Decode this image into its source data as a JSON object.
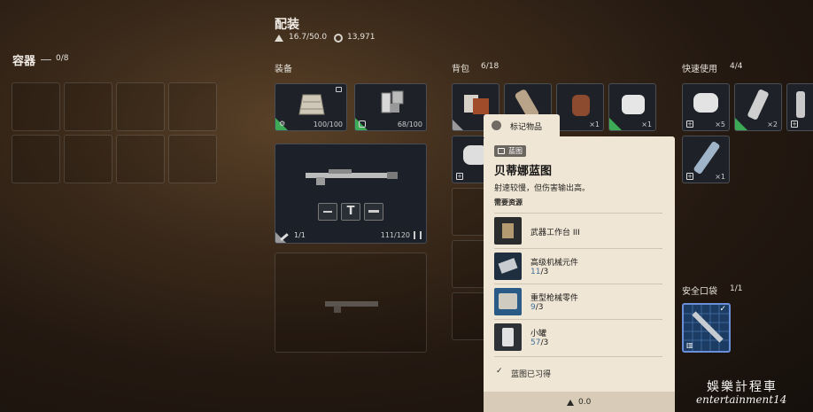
{
  "header": {
    "title": "配装",
    "weight": "16.7/50.0",
    "credits": "13,971"
  },
  "container": {
    "title": "容器",
    "count": "0/8"
  },
  "equipment": {
    "title": "装备",
    "shield": {
      "durability": "100/100",
      "icon": "shield-icon"
    },
    "augment": {
      "durability": "68/100",
      "icon": "augment-icon"
    },
    "weapon": {
      "count": "1/1",
      "ammo": "111/120",
      "attachments": [
        "barrel-icon",
        "tech-icon",
        "stock-icon"
      ]
    }
  },
  "backpack": {
    "title": "背包",
    "count": "6/18",
    "items": [
      {
        "qty": ""
      },
      {
        "qty": ""
      },
      {
        "qty": "×1"
      },
      {
        "qty": "×1"
      },
      {
        "qty": ""
      }
    ]
  },
  "quick_use": {
    "title": "快速使用",
    "count": "4/4",
    "items": [
      {
        "qty": "×5"
      },
      {
        "qty": "×2"
      },
      {
        "qty": ""
      },
      {
        "qty": "×1"
      }
    ]
  },
  "safe_pocket": {
    "title": "安全口袋",
    "count": "1/1"
  },
  "tooltip": {
    "mark_label": "标记物品",
    "tag": "蓝图",
    "name": "贝蒂娜蓝图",
    "desc": "射速较慢，但伤害输出高。",
    "resources_title": "需要资源",
    "resources": [
      {
        "name": "武器工作台 III",
        "have": "",
        "need": ""
      },
      {
        "name": "高级机械元件",
        "have": "11",
        "need": "/3"
      },
      {
        "name": "重型枪械零件",
        "have": "9",
        "need": "/3"
      },
      {
        "name": "小罐",
        "have": "57",
        "need": "/3"
      }
    ],
    "learned": "蓝图已习得",
    "weight": "0.0"
  },
  "watermark": {
    "line1": "娛樂計程車",
    "line2": "entertainment14"
  },
  "colors": {
    "accent_green": "#3dab55",
    "tooltip_bg": "#efe6d6",
    "resource_blue": "#3e6f98",
    "safe_pocket_border": "#6a8fd8"
  }
}
